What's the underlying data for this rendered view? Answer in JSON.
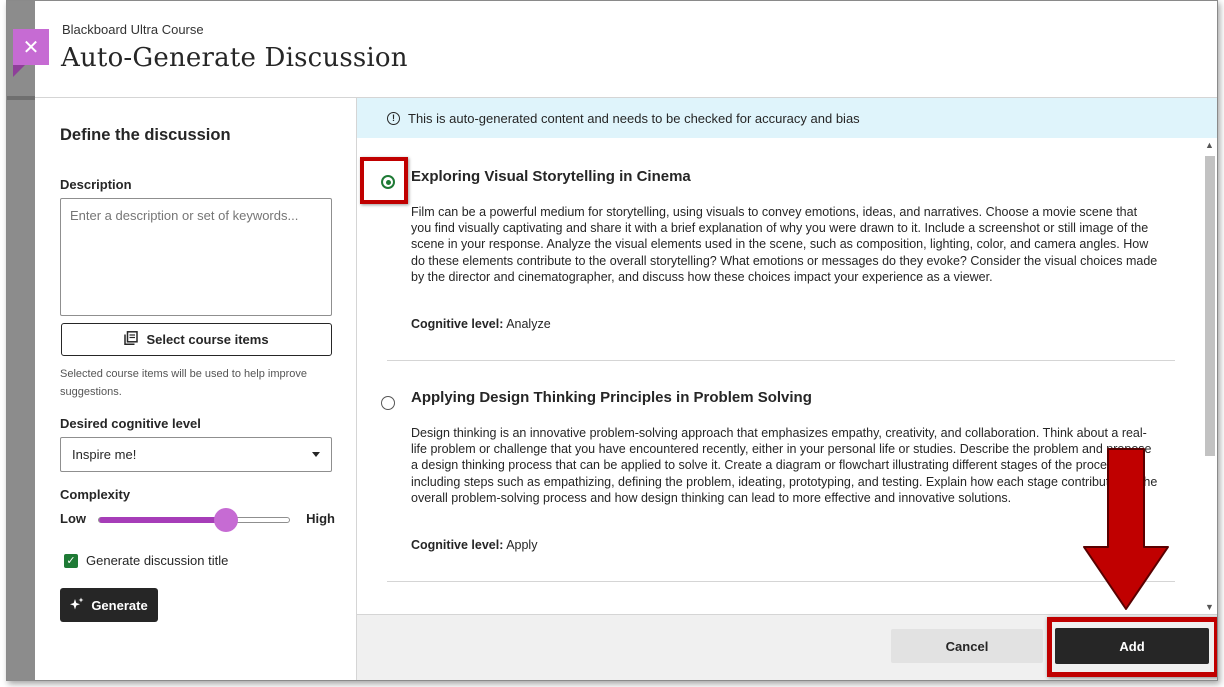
{
  "header": {
    "breadcrumb": "Blackboard Ultra Course",
    "title": "Auto-Generate Discussion",
    "close_icon": "close-icon"
  },
  "left_panel": {
    "heading": "Define the discussion",
    "description_label": "Description",
    "description_placeholder": "Enter a description or set of keywords...",
    "select_button_label": "Select course items",
    "select_hint": "Selected course items will be used to help improve suggestions.",
    "cognitive_label": "Desired cognitive level",
    "cognitive_value": "Inspire me!",
    "complexity_label": "Complexity",
    "complexity_low": "Low",
    "complexity_high": "High",
    "complexity_level": 0.66,
    "generate_title_label": "Generate discussion title",
    "generate_title_checked": true,
    "generate_button_label": "Generate"
  },
  "right_panel": {
    "banner_text": "This is auto-generated content and needs to be checked for accuracy and bias",
    "options": [
      {
        "title": "Exploring Visual Storytelling in Cinema",
        "description": "Film can be a powerful medium for storytelling, using visuals to convey emotions, ideas, and narratives. Choose a movie scene that you find visually captivating and share it with a brief explanation of why you were drawn to it. Include a screenshot or still image of the scene in your response. Analyze the visual elements used in the scene, such as composition, lighting, color, and camera angles. How do these elements contribute to the overall storytelling? What emotions or messages do they evoke? Consider the visual choices made by the director and cinematographer, and discuss how these choices impact your experience as a viewer.",
        "cognitive_label": "Cognitive level:",
        "cognitive_value": "Analyze",
        "selected": true
      },
      {
        "title": "Applying Design Thinking Principles in Problem Solving",
        "description": "Design thinking is an innovative problem-solving approach that emphasizes empathy, creativity, and collaboration. Think about a real-life problem or challenge that you have encountered recently, either in your personal life or studies. Describe the problem and propose a design thinking process that can be applied to solve it. Create a diagram or flowchart illustrating different stages of the process, including steps such as empathizing, defining the problem, ideating, prototyping, and testing. Explain how each stage contributes to the overall problem-solving process and how design thinking can lead to more effective and innovative solutions.",
        "cognitive_label": "Cognitive level:",
        "cognitive_value": "Apply",
        "selected": false
      }
    ]
  },
  "footer": {
    "cancel_label": "Cancel",
    "add_label": "Add"
  },
  "colors": {
    "accent_purple": "#c66bd3",
    "slider_fill": "#a63db8",
    "checkbox_green": "#1e7a35",
    "highlight_red": "#c00000",
    "banner_bg": "#dff4fb",
    "dark_button": "#262626"
  }
}
